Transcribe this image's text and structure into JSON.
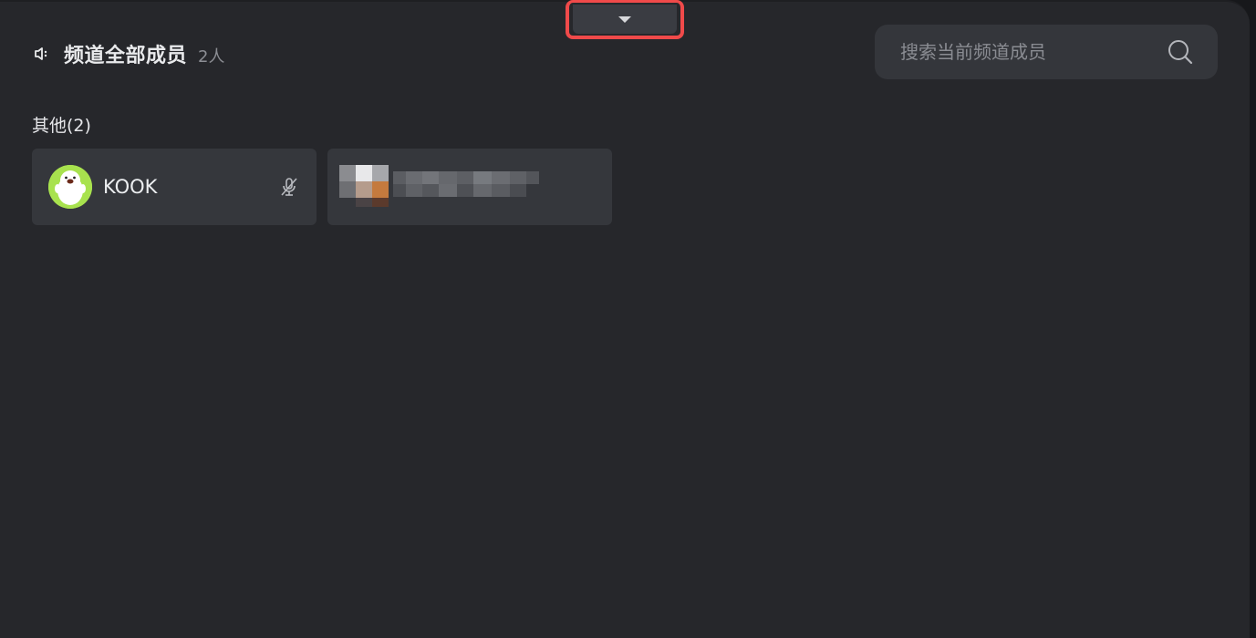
{
  "header": {
    "title": "频道全部成员",
    "count": "2人",
    "icon": "speaker-icon"
  },
  "search": {
    "placeholder": "搜索当前频道成员",
    "icon": "search-icon"
  },
  "collapse": {
    "icon": "caret-down-icon",
    "highlight_color": "#f04a4a"
  },
  "group": {
    "label": "其他(2)"
  },
  "members": [
    {
      "name": "KOOK",
      "avatar": "kook-mascot-avatar",
      "status_icon": "mic-muted-icon",
      "avatar_color": "#a8e24e"
    },
    {
      "name": "",
      "avatar": "pixelated-avatar",
      "blurred": true
    }
  ],
  "colors": {
    "background": "#26272b",
    "card": "#35373c",
    "search": "#34363b"
  }
}
